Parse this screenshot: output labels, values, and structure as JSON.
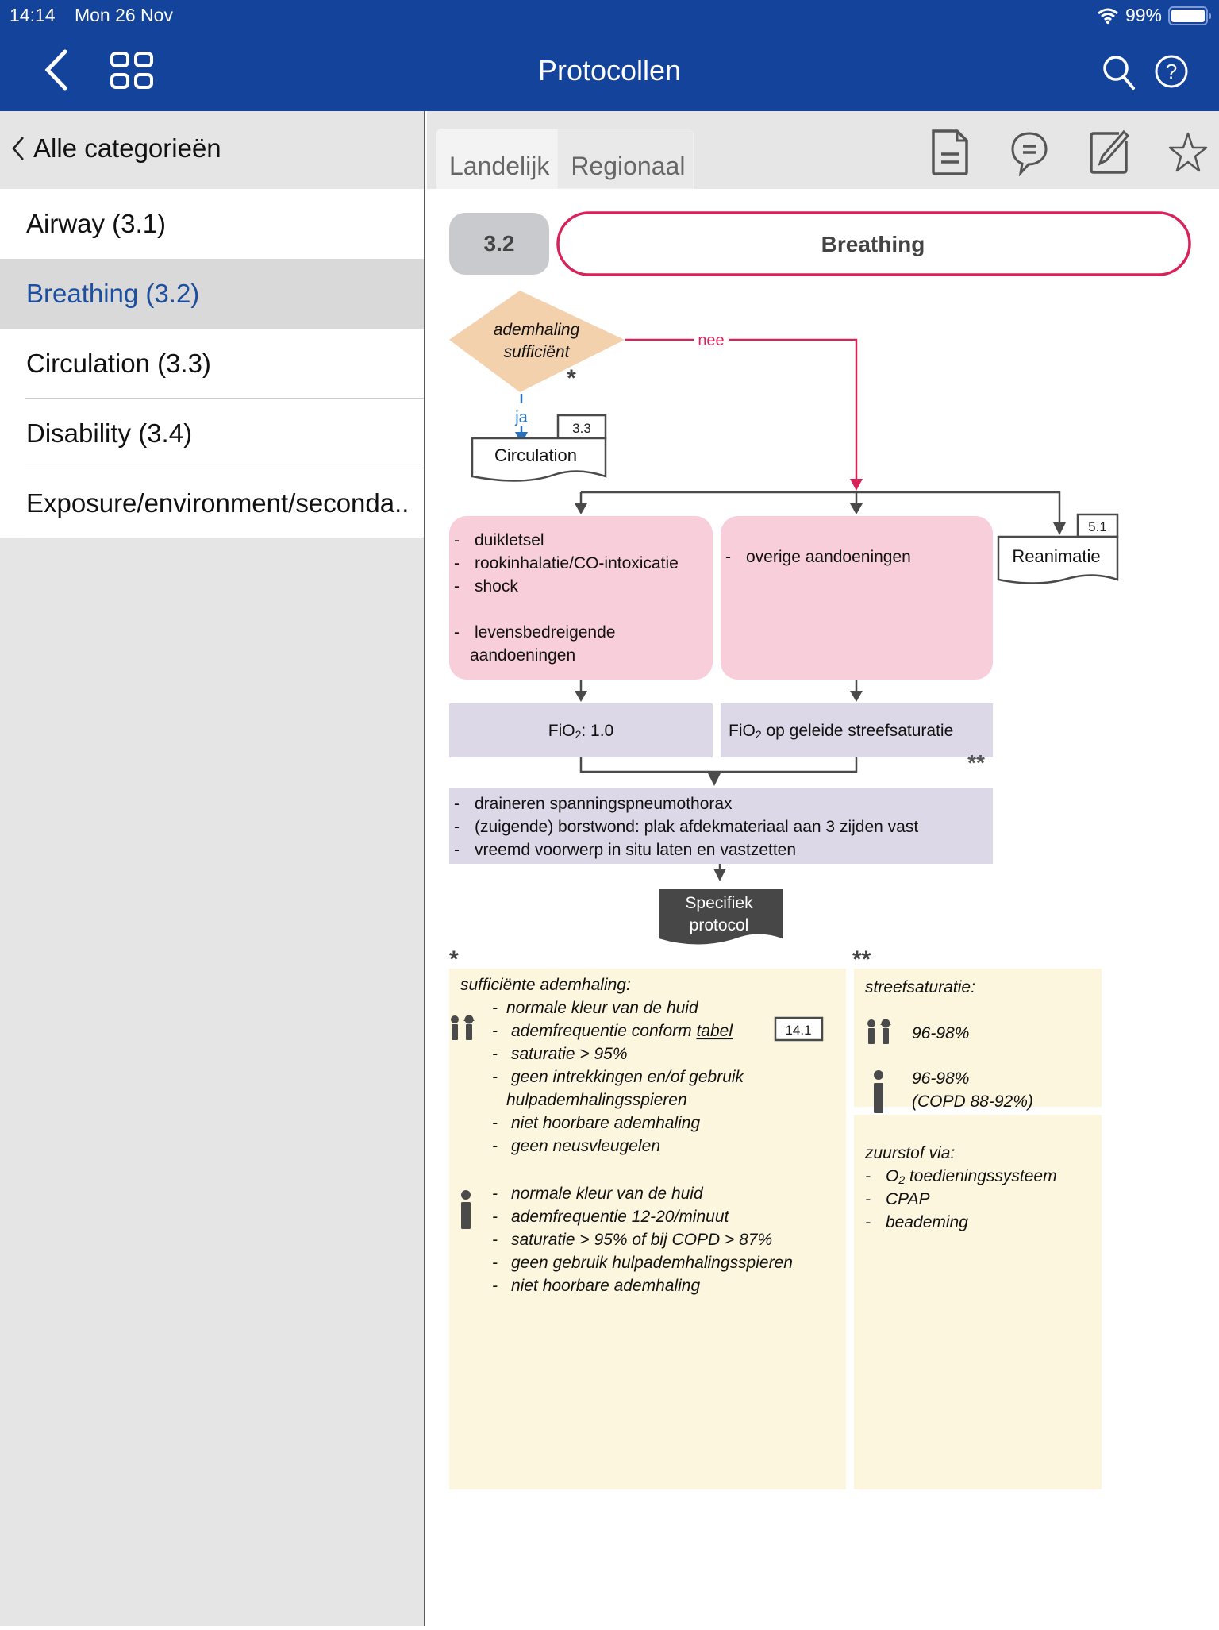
{
  "status_bar": {
    "time": "14:14",
    "date": "Mon 26 Nov",
    "battery": "99%"
  },
  "nav": {
    "title": "Protocollen"
  },
  "sidebar": {
    "back_label": "Alle categorieën",
    "items": [
      {
        "label": "Airway (3.1)"
      },
      {
        "label": "Breathing (3.2)"
      },
      {
        "label": "Circulation (3.3)"
      },
      {
        "label": "Disability (3.4)"
      },
      {
        "label": "Exposure/environment/seconda.."
      }
    ],
    "selected_index": 1
  },
  "tabs": [
    {
      "label": "Landelijk",
      "selected": true
    },
    {
      "label": "Regionaal",
      "selected": false
    }
  ],
  "colors": {
    "brand": "#13439b",
    "accent_red": "#d8235a",
    "selected_text": "#1d4fa0",
    "pink_box": "#f7ced9",
    "lavender_box": "#dcd8e7",
    "cream_box": "#fdf6de",
    "decision": "#f4d1ad"
  },
  "protocol": {
    "number": "3.2",
    "title": "Breathing",
    "decision": {
      "line1": "ademhaling",
      "line2": "sufficiënt",
      "marker": "*"
    },
    "yes_label": "ja",
    "no_label": "nee",
    "circulation_ref": {
      "label": "Circulation",
      "code": "3.3"
    },
    "reanimatie_ref": {
      "label": "Reanimatie",
      "code": "5.1"
    },
    "left_conditions": [
      "duikletsel",
      "rookinhalatie/CO-intoxicatie",
      "shock",
      "levensbedreigende",
      "aandoeningen"
    ],
    "right_conditions": [
      "overige aandoeningen"
    ],
    "fio2_left": {
      "prefix": "FiO",
      "sub": "2",
      "suffix": ": 1.0"
    },
    "fio2_right": {
      "prefix": "FiO",
      "sub": "2",
      "suffix": " op geleide streefsaturatie",
      "marker": "**"
    },
    "actions": [
      "draineren spanningspneumothorax",
      "(zuigende) borstwond: plak afdekmateriaal aan 3 zijden vast",
      "vreemd voorwerp in situ laten en vastzetten"
    ],
    "specific": {
      "line1": "Specifiek",
      "line2": "protocol"
    },
    "note1": {
      "marker": "*",
      "title": "sufficiënte ademhaling:",
      "children": [
        "normale kleur van de huid",
        "ademfrequentie conform ",
        "saturatie > 95%",
        "geen intrekkingen en/of gebruik",
        "hulpademhalingsspieren",
        "niet hoorbare ademhaling",
        "geen neusvleugelen"
      ],
      "table_link": "tabel",
      "table_ref": "14.1",
      "adults": [
        "normale kleur van de huid",
        "ademfrequentie 12-20/minuut",
        "saturatie > 95% of bij COPD > 87%",
        "geen gebruik hulpademhalingsspieren",
        "niet hoorbare ademhaling"
      ]
    },
    "note2": {
      "marker": "**",
      "title": "streefsaturatie:",
      "children_value": "96-98%",
      "adults_value": "96-98%",
      "adults_copd": "(COPD 88-92%)"
    },
    "note3": {
      "title": "zuurstof via:",
      "items": [
        {
          "prefix": "O",
          "sub": "2",
          "suffix": " toedieningssysteem"
        },
        {
          "prefix": "CPAP",
          "sub": "",
          "suffix": ""
        },
        {
          "prefix": "beademing",
          "sub": "",
          "suffix": ""
        }
      ]
    }
  }
}
